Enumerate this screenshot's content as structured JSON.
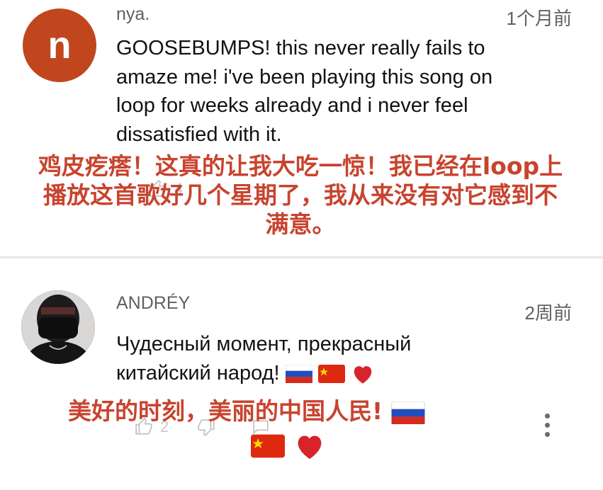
{
  "comments": [
    {
      "author": "nya.",
      "avatar_letter": "n",
      "time": "1个月前",
      "text_lines": [
        "GOOSEBUMPS! this never really fails to",
        "amaze me! i've been playing this song on",
        "loop for weeks already and i never feel",
        "dissatisfied with it."
      ],
      "like_count": "4",
      "overlay_lines": [
        "鸡皮疙瘩！这真的让我大吃一惊！我已经在loop上",
        "播放这首歌好几个星期了，我从来没有对它感到不",
        "满意。"
      ]
    },
    {
      "author": "ANDRÉY",
      "time": "2周前",
      "text_lines": [
        "Чудесный момент, прекрасный",
        "китайский народ!"
      ],
      "like_count": "2",
      "overlay_lines": [
        "美好的时刻，美丽的中国人民!",
        ""
      ]
    }
  ],
  "colors": {
    "overlay_text": "#c8432e",
    "avatar_bg": "#c2461d",
    "secondary_text": "#606060"
  },
  "icons": [
    "thumb-up-icon",
    "thumb-down-icon",
    "reply-icon",
    "more-vert-icon",
    "russia-flag-icon",
    "china-flag-icon",
    "red-heart-icon"
  ]
}
